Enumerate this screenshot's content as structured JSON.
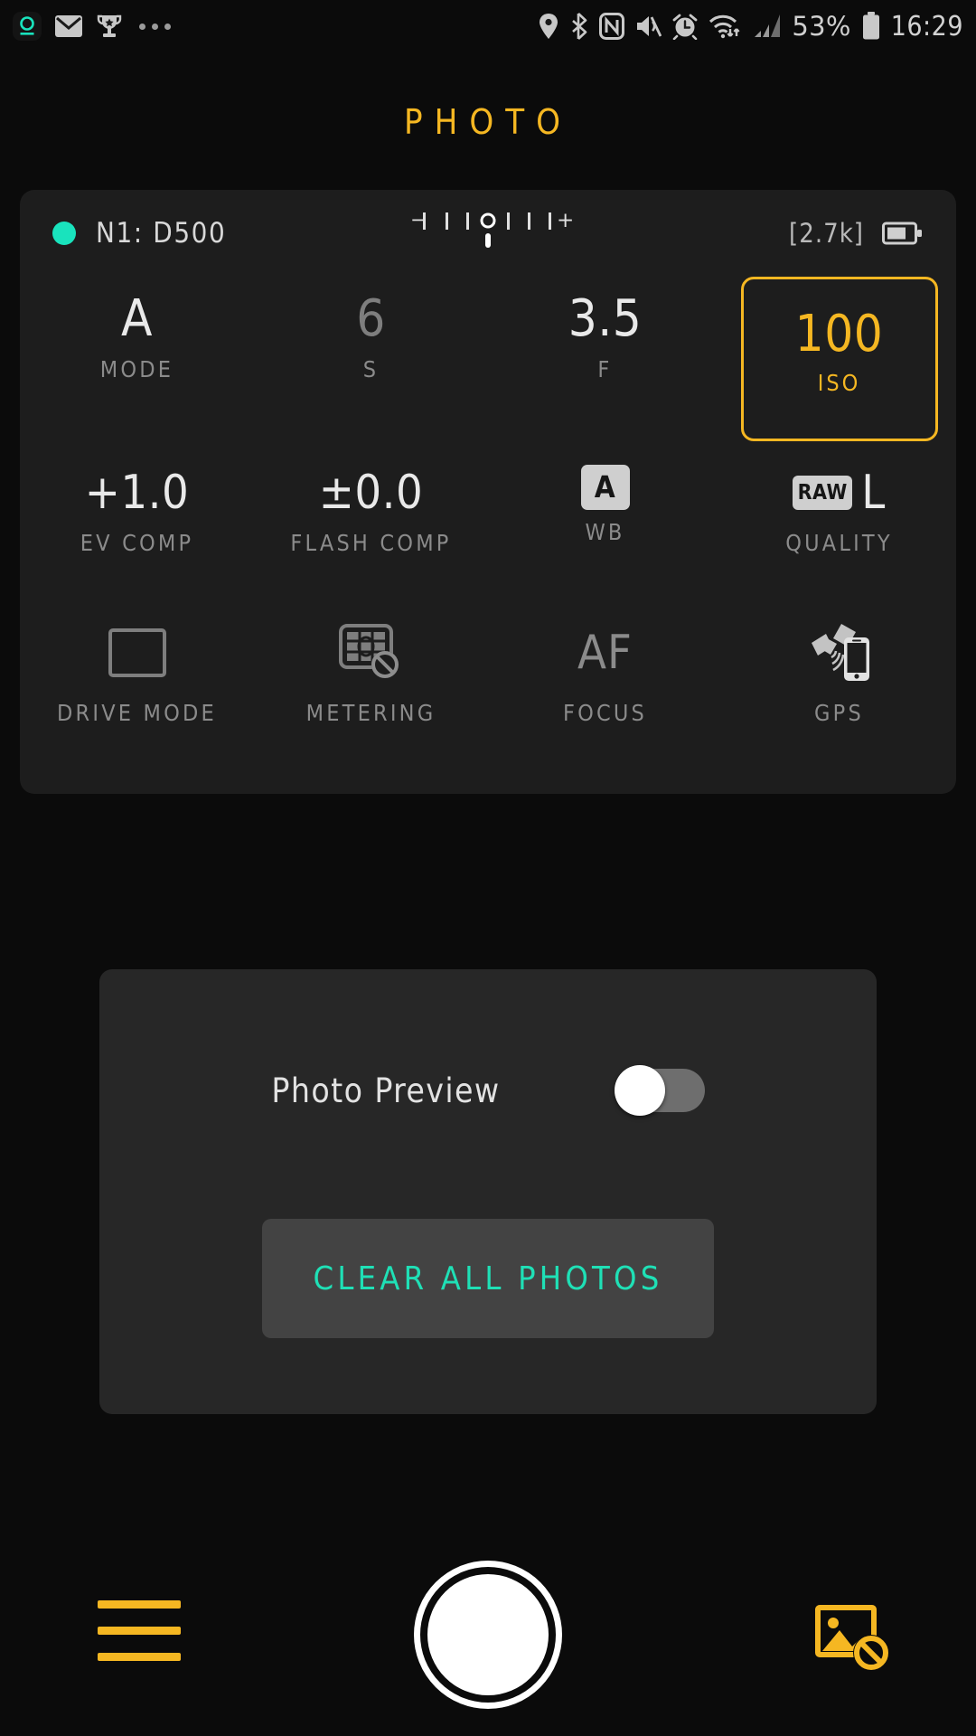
{
  "statusbar": {
    "left_icons": [
      "app-circle-icon",
      "mail-icon",
      "trophy-icon",
      "more-dots-icon"
    ],
    "right_icons": [
      "location-icon",
      "bluetooth-icon",
      "nfc-icon",
      "mute-icon",
      "alarm-icon",
      "wifi-icon",
      "cellular-signal-icon"
    ],
    "battery_percent": "53%",
    "battery_icon": "battery-icon",
    "time": "16:29"
  },
  "header": {
    "title": "PHOTO"
  },
  "camera": {
    "status_dot_color": "#19e3bd",
    "name": "N1: D500",
    "meter": {
      "minus_label": "-|",
      "plus_label": "|+",
      "ticks": 4,
      "indicator_position": "center"
    },
    "shots_remaining": "[2.7k]",
    "battery_icon": "camera-battery-icon",
    "rows": [
      [
        {
          "value": "A",
          "label": "MODE",
          "dim": false
        },
        {
          "value": "6",
          "label": "S",
          "dim": true
        },
        {
          "value": "3.5",
          "label": "F",
          "dim": false
        },
        {
          "value": "100",
          "label": "ISO",
          "selected": true
        }
      ],
      [
        {
          "value": "+1.0",
          "label": "EV COMP"
        },
        {
          "value": "±0.0",
          "label": "FLASH COMP"
        },
        {
          "badge": "A",
          "label": "WB"
        },
        {
          "badge": "RAW",
          "value": "L",
          "label": "QUALITY"
        }
      ],
      [
        {
          "icon": "drive-mode-icon",
          "label": "DRIVE MODE"
        },
        {
          "icon": "metering-disabled-icon",
          "label": "METERING"
        },
        {
          "icon": "af-icon",
          "value": "AF",
          "label": "FOCUS"
        },
        {
          "icon": "gps-icon",
          "label": "GPS"
        }
      ]
    ]
  },
  "settings": {
    "photo_preview_label": "Photo Preview",
    "photo_preview_on": false,
    "clear_all_label": "CLEAR ALL PHOTOS"
  },
  "bottom_bar": {
    "menu_icon": "hamburger-menu-icon",
    "shutter_icon": "shutter-button",
    "gallery_icon": "gallery-disabled-icon"
  },
  "colors": {
    "accent_amber": "#f5b722",
    "accent_teal": "#1fe0b6",
    "card_bg": "#1d1d1d",
    "panel_bg": "#272727",
    "page_bg": "#0b0b0b"
  }
}
